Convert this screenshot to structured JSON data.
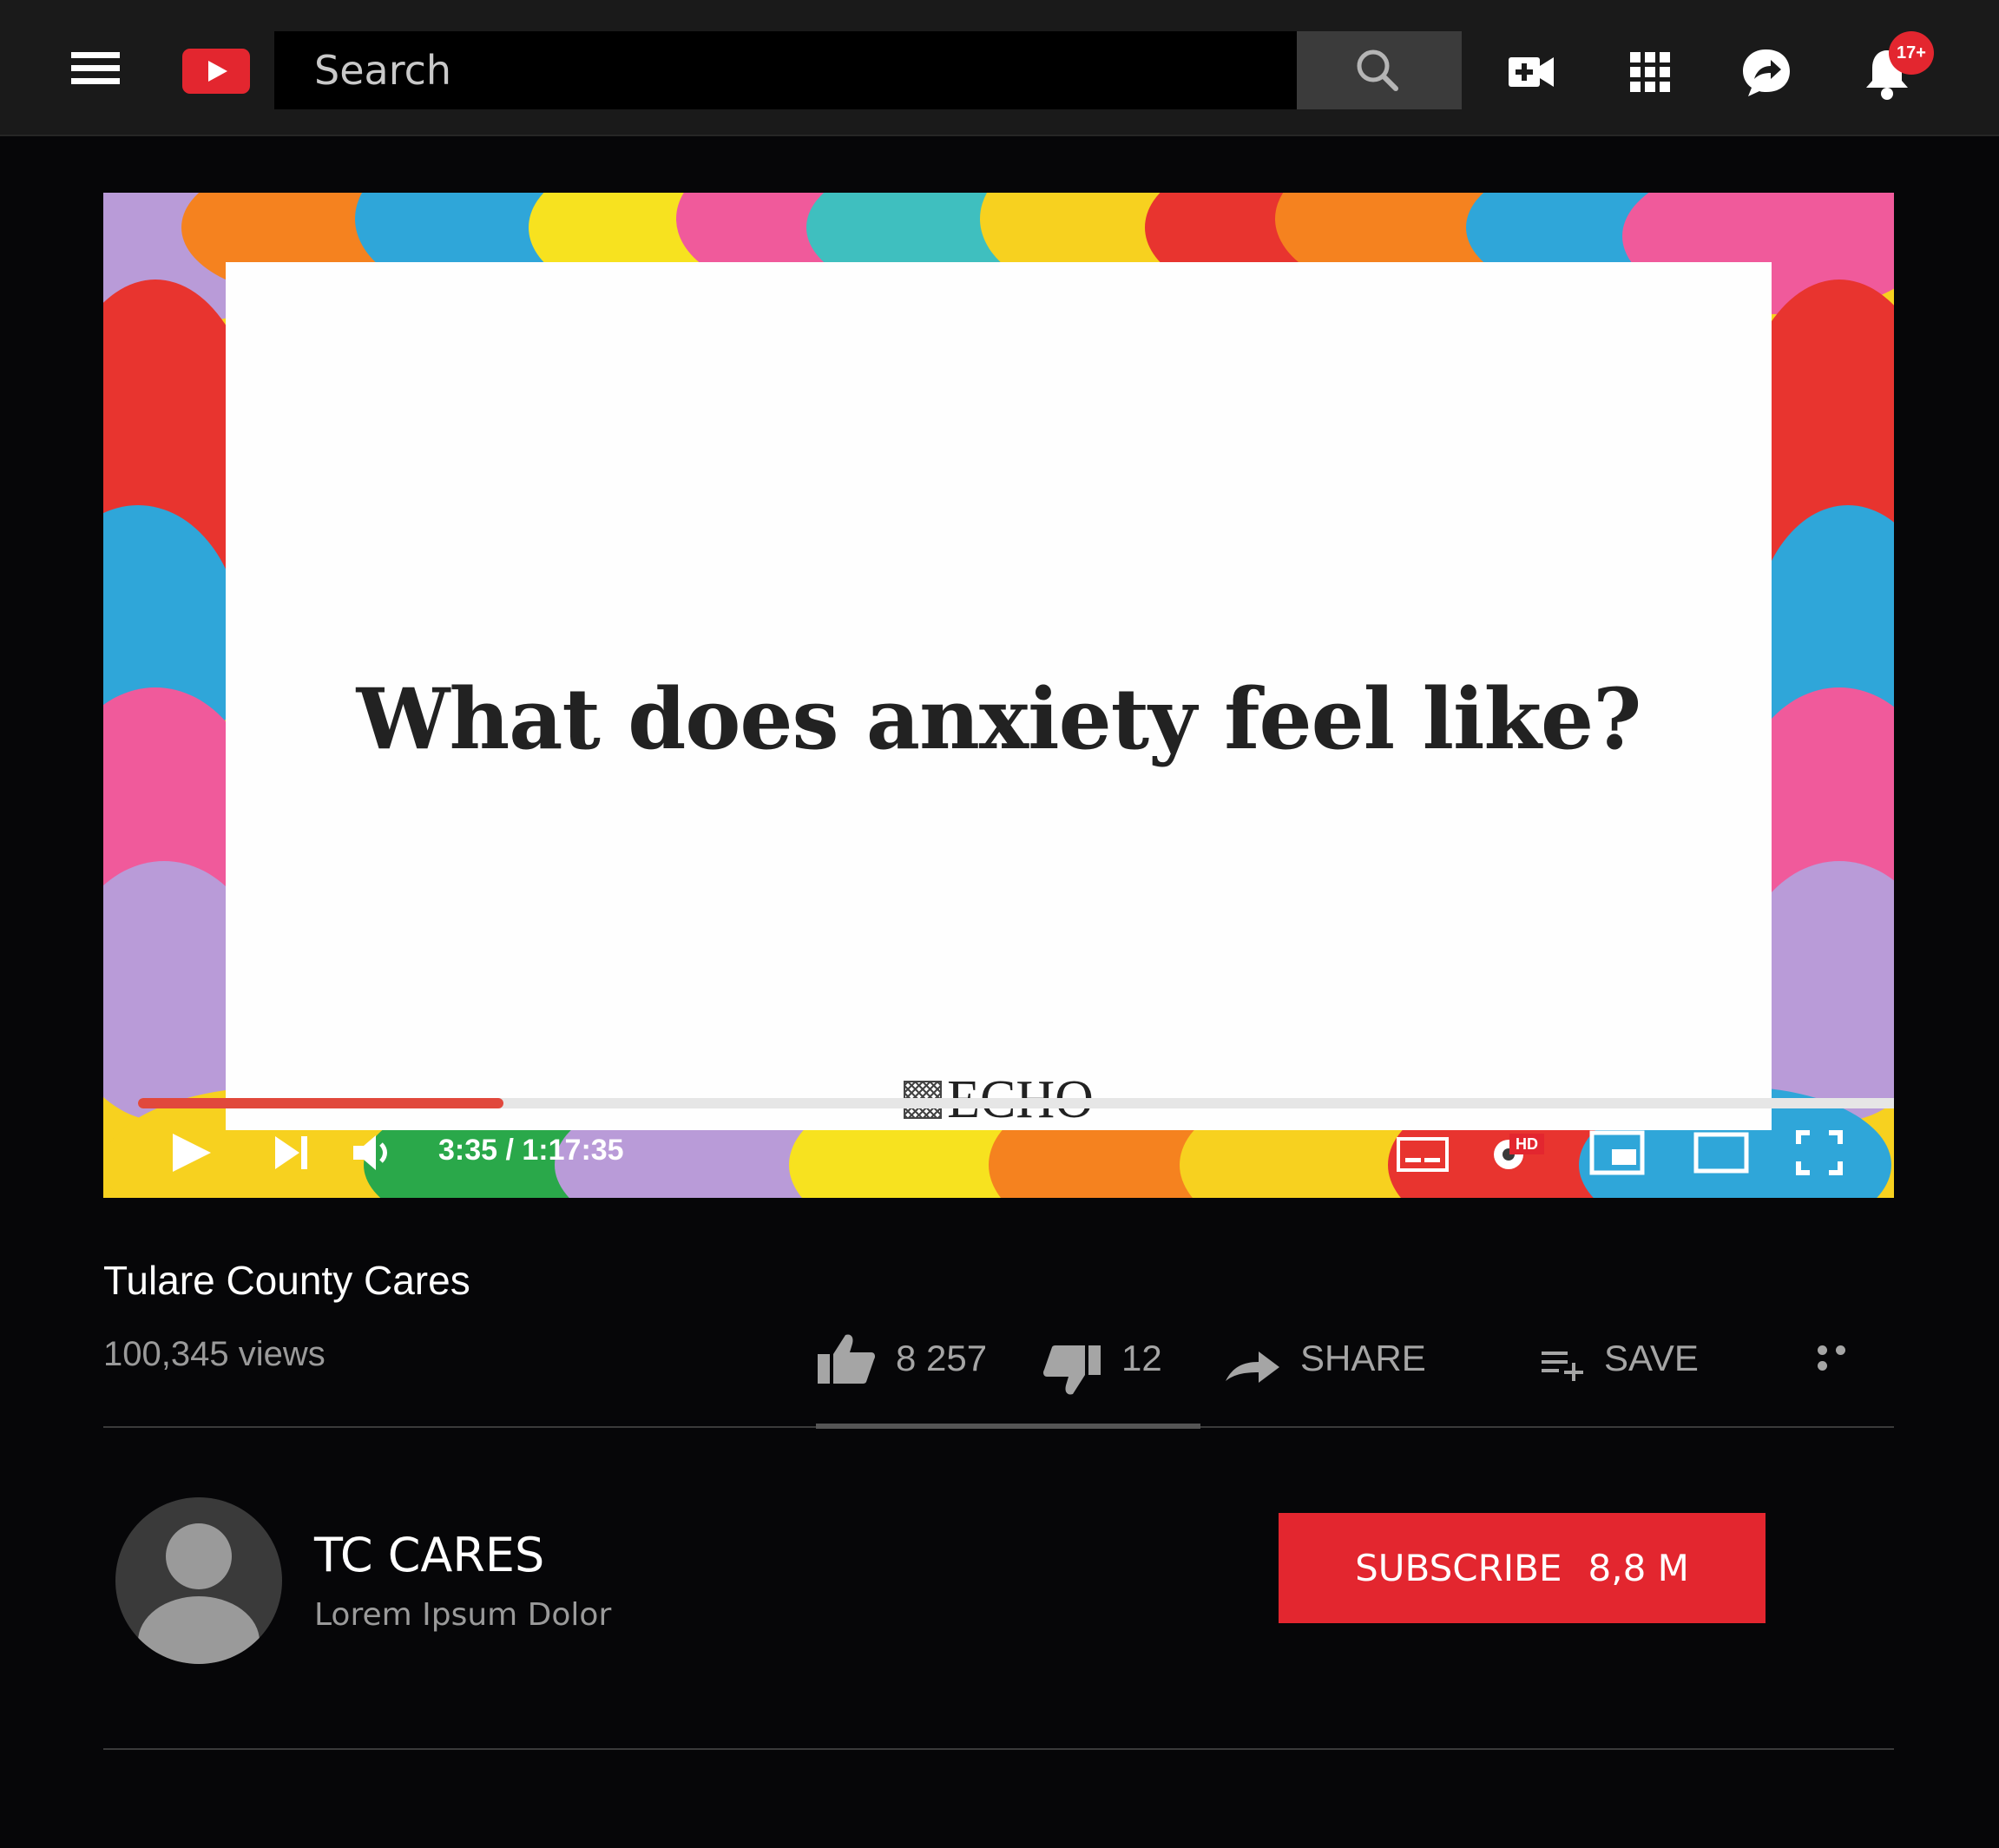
{
  "header": {
    "search_placeholder": "Search",
    "notification_count": "17+"
  },
  "player": {
    "slide_title": "What does anxiety feel like?",
    "slide_logo": "ECHO",
    "time_display": "3:35 / 1:17:35",
    "progress_fraction": 0.2,
    "hd_badge": "HD",
    "progress_color": "#e1483c"
  },
  "video": {
    "title": "Tulare County Cares",
    "views": "100,345 views",
    "likes": "8 257",
    "dislikes": "12",
    "share_label": "SHARE",
    "save_label": "SAVE"
  },
  "channel": {
    "name": "TC CARES",
    "subtitle": "Lorem Ipsum Dolor",
    "subscribe_label": "SUBSCRIBE",
    "subscriber_count": "8,8 M"
  },
  "colors": {
    "brand_red": "#e3262f",
    "background": "#060608",
    "topbar": "#1a1a1a"
  },
  "icons": [
    "menu-icon",
    "youtube-logo",
    "search-icon",
    "create-video-icon",
    "apps-grid-icon",
    "messages-icon",
    "notifications-bell-icon",
    "play-icon",
    "next-icon",
    "volume-icon",
    "captions-icon",
    "settings-icon",
    "miniplayer-icon",
    "theater-icon",
    "fullscreen-icon",
    "thumbs-up-icon",
    "thumbs-down-icon",
    "share-icon",
    "save-playlist-icon",
    "more-icon",
    "avatar-icon"
  ]
}
